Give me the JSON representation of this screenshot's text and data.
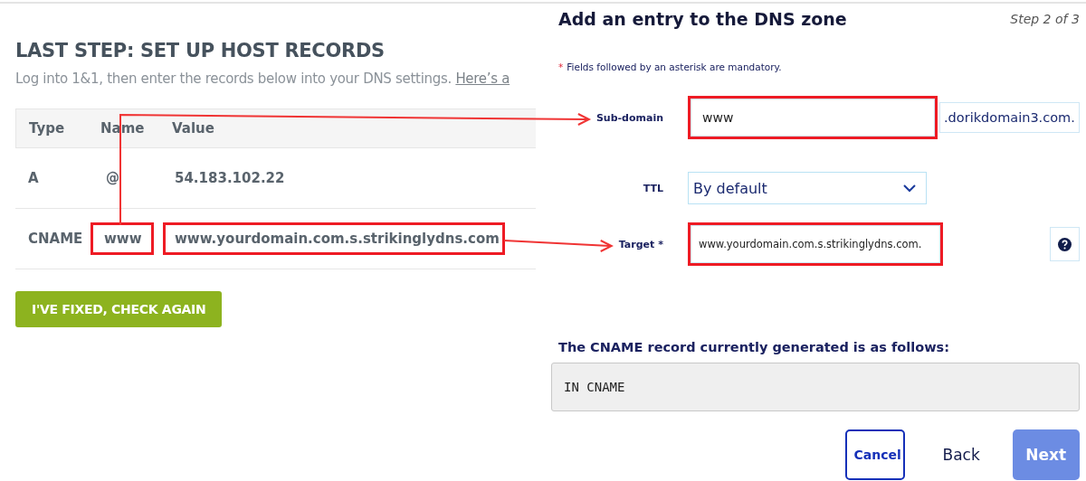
{
  "host_records": {
    "title": "LAST STEP: SET UP HOST RECORDS",
    "intro": "Log into 1&1, then enter the records below into your DNS settings.",
    "intro_link": "Here’s a",
    "columns": [
      "Type",
      "Name",
      "Value"
    ],
    "rows": [
      {
        "type": "A",
        "name": "@",
        "value": "54.183.102.22",
        "highlighted": false
      },
      {
        "type": "CNAME",
        "name": "www",
        "value": "www.yourdomain.com.s.strikinglydns.com",
        "highlighted": true
      }
    ],
    "button": "I'VE FIXED, CHECK AGAIN"
  },
  "dns_entry": {
    "title": "Add an entry to the DNS zone",
    "step": "Step 2 of 3",
    "note_mark": "*",
    "note": "Fields followed by an asterisk are mandatory.",
    "fields": [
      {
        "kind": "text",
        "label": "Sub-domain",
        "value": "www",
        "suffix": ".dorikdomain3.com.",
        "highlighted": true,
        "arrow": true
      },
      {
        "kind": "select",
        "label": "TTL",
        "value": "By default",
        "highlighted": false
      },
      {
        "kind": "text",
        "label": "Target",
        "required_mark": "*",
        "value": "www.yourdomain.com.s.strikinglydns.com.",
        "help": true,
        "highlighted": true,
        "arrow": true
      }
    ],
    "record_label": "The CNAME record currently generated is as follows:",
    "record": "IN CNAME",
    "buttons": [
      {
        "kind": "outline",
        "label": "Cancel"
      },
      {
        "kind": "plain",
        "label": "Back"
      },
      {
        "kind": "primary",
        "label": "Next"
      }
    ]
  }
}
